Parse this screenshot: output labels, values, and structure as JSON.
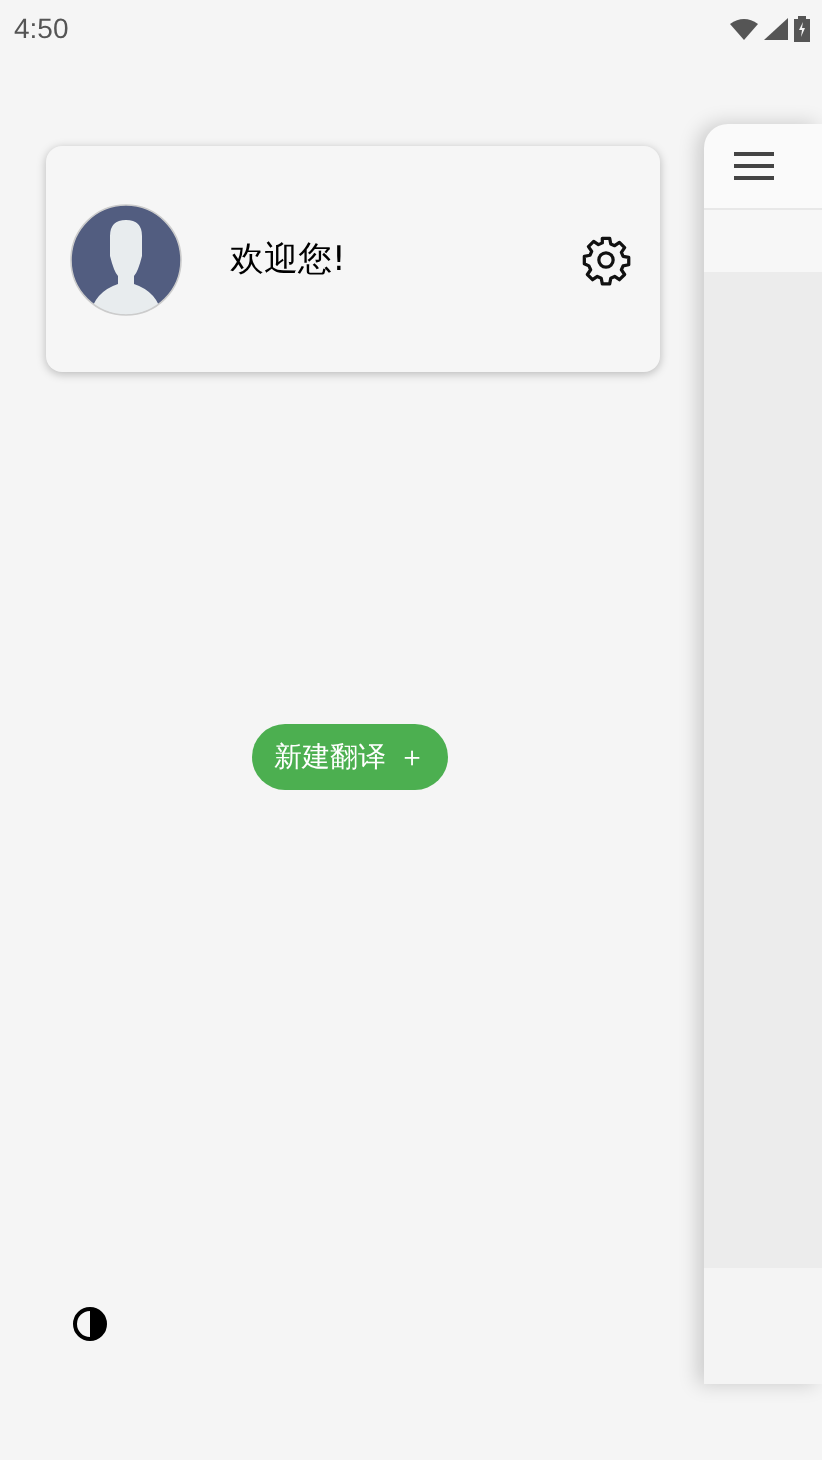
{
  "status_bar": {
    "time": "4:50"
  },
  "drawer": {
    "profile": {
      "greeting": "欢迎您!"
    },
    "new_button": {
      "label": "新建翻译",
      "icon": "＋"
    }
  }
}
